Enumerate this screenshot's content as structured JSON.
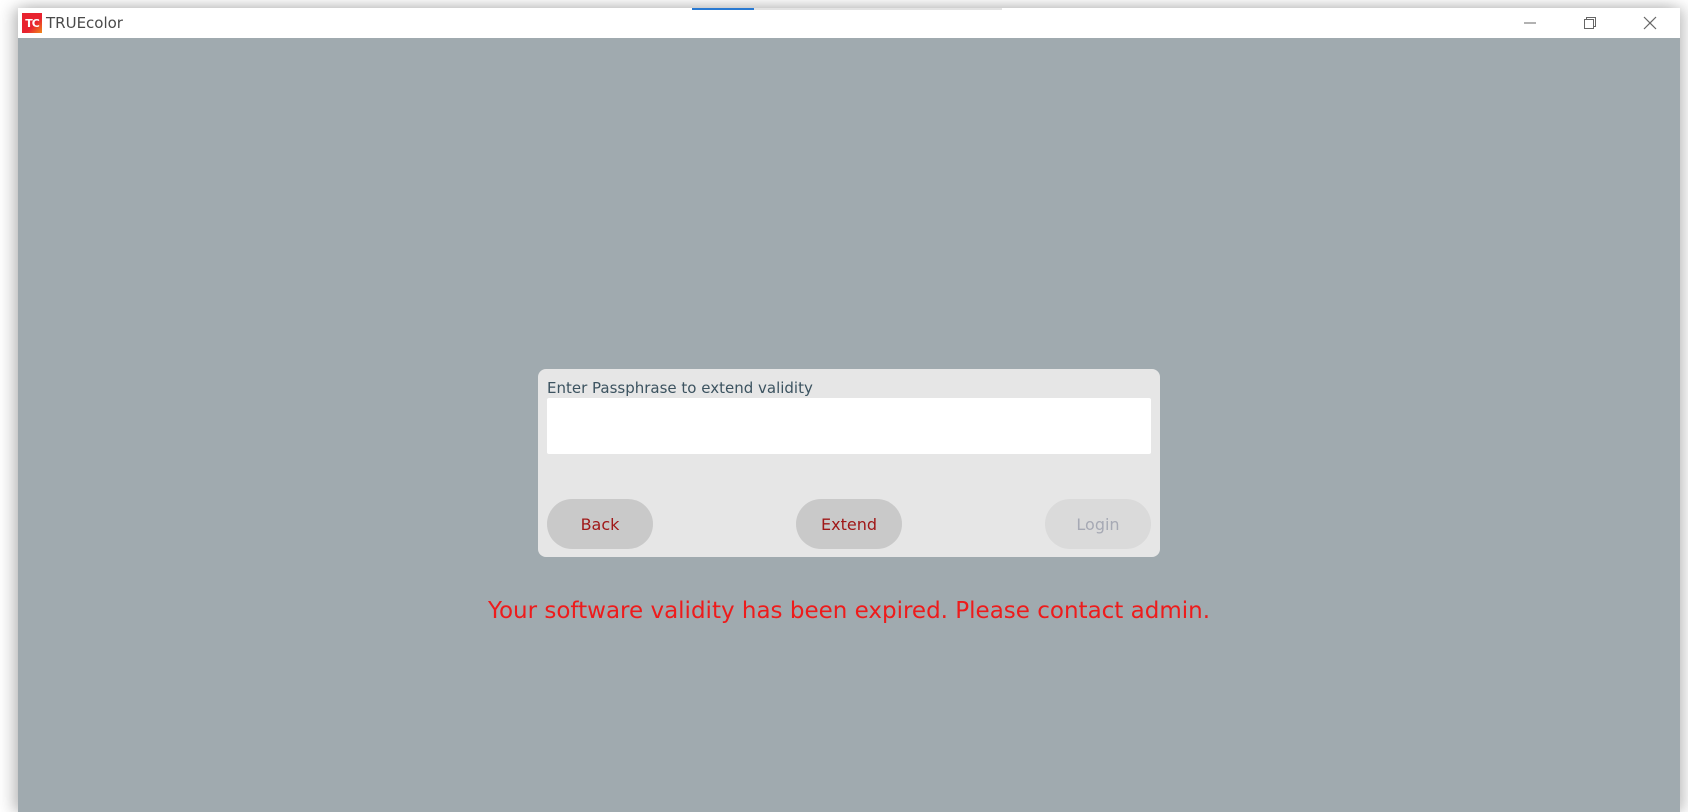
{
  "window": {
    "title": "TRUEcolor",
    "icon_text": "TC",
    "progress_fraction": 0.2
  },
  "dialog": {
    "label": "Enter Passphrase to extend validity",
    "passphrase_value": "",
    "back_label": "Back",
    "extend_label": "Extend",
    "login_label": "Login"
  },
  "error": {
    "message": "Your software validity has been expired. Please contact admin."
  },
  "colors": {
    "background": "#a0aaaf",
    "dialog": "#e6e6e6",
    "button_text": "#a01818",
    "error_text": "#ee1b1b",
    "disabled_text": "#a6a9b4"
  }
}
